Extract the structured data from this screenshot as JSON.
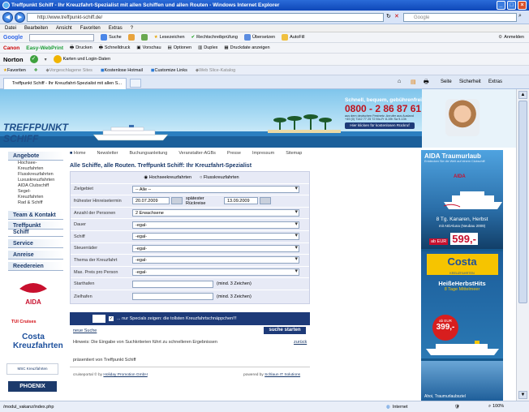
{
  "window": {
    "title": "Treffpunkt Schiff - Ihr Kreuzfahrt-Spezialist mit allen Schiffen und allen Routen - Windows Internet Explorer"
  },
  "address": {
    "url": "http://www.treffpunkt-schiff.de/",
    "search_placeholder": "Google"
  },
  "menu": [
    "Datei",
    "Bearbeiten",
    "Ansicht",
    "Favoriten",
    "Extras",
    "?"
  ],
  "google_toolbar": {
    "brand": "Google",
    "items": [
      "Suche",
      "Lesezeichen",
      "Rechtschreibprüfung",
      "Übersetzen",
      "AutoFill",
      "Anmelden"
    ]
  },
  "canon_toolbar": {
    "brand": "Canon",
    "product": "Easy-WebPrint",
    "items": [
      "Drucken",
      "Schnelldruck",
      "Vorschau",
      "Optionen",
      "Duplex",
      "Druckdate anzeigen"
    ]
  },
  "norton_toolbar": {
    "brand": "Norton",
    "items": [
      "Karten und Login-Daten"
    ]
  },
  "favorites_bar": {
    "label": "Favoriten",
    "items": [
      "Vorgeschlagene Sites",
      "Kostenlose Hotmail",
      "Customize Links",
      "Web Slice-Katalog"
    ]
  },
  "tab": {
    "title": "Treffpunkt Schiff - Ihr Kreuzfahrt-Spezialist mit allen S..."
  },
  "command_bar": [
    "Seite",
    "Sicherheit",
    "Extras"
  ],
  "site": {
    "logo": "TREFFPUNKT SCHIFF",
    "slogan": "Schnell, bequem, gebührenfrei",
    "phone": "0800 - 2 86 87 61",
    "phone_note1": "aus dem deutschen Festnetz. Anrufer aus Ausland",
    "phone_note2": "+49 (0) 7142 77 25 72  Mo-Fr 8-19h  Sa 9-13h",
    "callback": "Hier klicken für kostenlosen Rückruf",
    "topnav": [
      "Home",
      "Newsletter",
      "Buchungsanleitung",
      "Veranstalter-AGBs",
      "Presse",
      "Impressum",
      "Sitemap"
    ],
    "sidenav": {
      "angebote": "Angebote",
      "angebote_items": [
        "Hochsee-",
        "Kreuzfahrten",
        "Flusskreuzfahrten",
        "Luxuskreuzfahrten",
        "AIDA Clubschiff",
        "Segel-",
        "Kreuzfahrten",
        "Rad & Schiff"
      ],
      "team": "Team & Kontakt",
      "treff1": "Treffpunkt",
      "treff2": "Schiff",
      "service": "Service",
      "anreise": "Anreise",
      "reedereien": "Reedereien"
    },
    "logos": [
      "AIDA",
      "TUI Cruises",
      "Costa Kreuzfahrten",
      "MSC Kreuzfahrten",
      "PHOENIX"
    ],
    "form": {
      "title": "Alle Schiffe, alle Routen. Treffpunkt Schiff: Ihr Kreuzfahrt-Spezialist",
      "radio1": "Hochseekreuzfahrten",
      "radio2": "Flusskreuzfahrten",
      "zielgebiet": "Zielgebiet",
      "zielgebiet_val": "-- Alle --",
      "abreise": "frühester Hinreisetermin",
      "abreise_val": "20.07.2009",
      "rueck": "spätester Rückreise",
      "rueck_val": "13.09.2009",
      "personen": "Anzahl der Personen",
      "personen_val": "2 Erwachsene",
      "dauer": "Dauer",
      "schiff": "Schiff",
      "steuer": "Steuerräder",
      "thema": "Thema der Kreuzfahrt",
      "preis": "Max. Preis pro Person",
      "egal": "-egal-",
      "start": "Starthafen",
      "ziel": "Zielhafen",
      "hint": "(mind. 3 Zeichen)",
      "specials": "... nur Specials zeigen: die tollsten Kreuzfahrtschnäppchen!!!",
      "new_search": "neue Suche",
      "submit": "suche starten",
      "hinweis": "Hinweis: Die Eingabe von Suchkriterien führt zu schnelleren Ergebnissen",
      "back": "zurück",
      "presented": "präsentiert von Treffpunkt Schiff",
      "footer_left": "cruiseportal © by",
      "footer_link": "Holiday Promotion GmbH",
      "footer_right": "powered by",
      "footer_right_link": "Schlaun IT Solutions"
    },
    "ads": {
      "aida_title": "AIDA Traumurlaub",
      "aida_sub": "Entdecken Sie die Welt auf einem Clubschiff",
      "aida_logo": "AIDA",
      "aida_offer": "8 Tg. Kanaren, Herbst",
      "aida_ship": "mit AIDAluna (Neubau 2009)",
      "aida_from": "ab EUR",
      "aida_price": "599,-",
      "costa_logo": "Costa",
      "costa_sub": "KREUZFAHRTEN",
      "costa_title": "HeißeHerbstHits",
      "costa_offer": "8 Tage Mittelmeer",
      "costa_from": "ab EUR",
      "costa_price": "399,-",
      "ahoi": "Ahoi, Traumurlaubsziel"
    }
  },
  "status": {
    "url": "/modul_vakanz/index.php",
    "zone": "Internet",
    "zoom": "100%"
  }
}
